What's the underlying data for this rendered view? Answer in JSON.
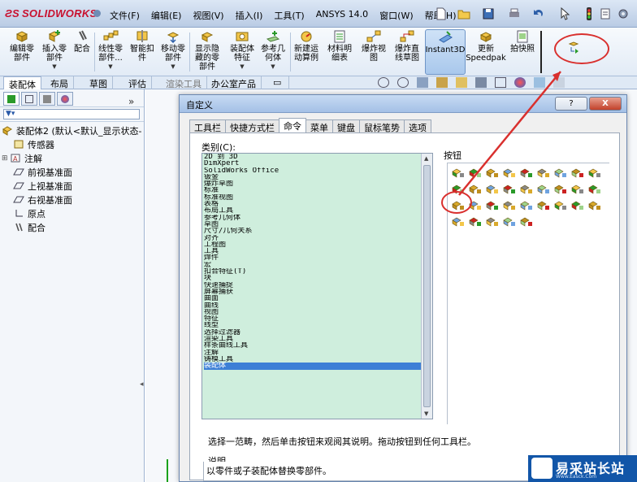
{
  "app": {
    "logo": "SOLIDWORKS",
    "menu": [
      "文件(F)",
      "编辑(E)",
      "视图(V)",
      "插入(I)",
      "工具(T)",
      "ANSYS 14.0",
      "窗口(W)",
      "帮助(H)"
    ]
  },
  "ribbon": {
    "buttons": [
      {
        "label": "编辑零\n部件",
        "icon": "edit-component-icon"
      },
      {
        "label": "插入零\n部件",
        "icon": "insert-component-icon"
      },
      {
        "label": "配合",
        "icon": "mate-icon"
      },
      {
        "label": "线性零\n部件...",
        "icon": "linear-pattern-icon"
      },
      {
        "label": "智能扣\n件",
        "icon": "smart-fastener-icon"
      },
      {
        "label": "移动零\n部件",
        "icon": "move-component-icon"
      },
      {
        "label": "显示隐\n藏的零\n部件",
        "icon": "show-hidden-icon"
      },
      {
        "label": "装配体\n特征",
        "icon": "assembly-feature-icon"
      },
      {
        "label": "参考几\n何体",
        "icon": "reference-geometry-icon"
      },
      {
        "label": "新建运\n动算例",
        "icon": "motion-study-icon"
      },
      {
        "label": "材料明\n细表",
        "icon": "bom-icon"
      },
      {
        "label": "爆炸视\n图",
        "icon": "exploded-view-icon"
      },
      {
        "label": "爆炸直\n线草图",
        "icon": "explode-line-icon"
      },
      {
        "label": "Instant3D",
        "icon": "instant3d-icon"
      },
      {
        "label": "更新\nSpeedpak",
        "icon": "speedpak-icon"
      },
      {
        "label": "拍快照",
        "icon": "snapshot-icon"
      }
    ]
  },
  "cmd_tabs": [
    "装配体",
    "布局",
    "草图",
    "评估",
    "渲染工具",
    "办公室产品"
  ],
  "left_panel": {
    "tree": [
      {
        "label": "装配体2 (默认<默认_显示状态-",
        "icon": "assembly-icon"
      },
      {
        "label": "传感器",
        "icon": "sensor-icon"
      },
      {
        "label": "注解",
        "icon": "annotation-icon"
      },
      {
        "label": "前视基准面",
        "icon": "plane-icon"
      },
      {
        "label": "上视基准面",
        "icon": "plane-icon"
      },
      {
        "label": "右视基准面",
        "icon": "plane-icon"
      },
      {
        "label": "原点",
        "icon": "origin-icon"
      },
      {
        "label": "配合",
        "icon": "mates-icon"
      }
    ]
  },
  "dialog": {
    "title": "自定义",
    "help_btn": "?",
    "close_btn": "X",
    "tabs": [
      "工具栏",
      "快捷方式栏",
      "命令",
      "菜单",
      "键盘",
      "鼠标笔势",
      "选项"
    ],
    "selected_tab": "命令",
    "category_label": "类别(C):",
    "categories": [
      "2D 到 3D",
      "DimXpert",
      "SolidWorks Office",
      "钣金",
      "爆炸草图",
      "标准",
      "标准视图",
      "表格",
      "布局工具",
      "参考几何体",
      "草图",
      "尺寸/几何关系",
      "对齐",
      "工程图",
      "工具",
      "焊件",
      "宏",
      "扣合特征(T)",
      "块",
      "快速捕捉",
      "屏幕捕获",
      "曲面",
      "曲线",
      "视图",
      "特征",
      "线型",
      "选择过滤器",
      "渲染工具",
      "样条曲线工具",
      "注解",
      "铸模工具",
      "装配体"
    ],
    "selected_category": "装配体",
    "buttons_label": "按钮",
    "instruction": "选择一范畴，然后单击按钮来观阅其说明。拖动按钮到任何工具栏。",
    "description_label": "说明",
    "description_text": "以零件或子装配体替换零部件。"
  },
  "colors": {
    "annotation_red": "#d9302e",
    "category_bg": "#cfeedd",
    "selection_blue": "#3d7fd6"
  },
  "watermark": {
    "title": "易采站长站",
    "subtitle": "Www.Easck.Com"
  }
}
